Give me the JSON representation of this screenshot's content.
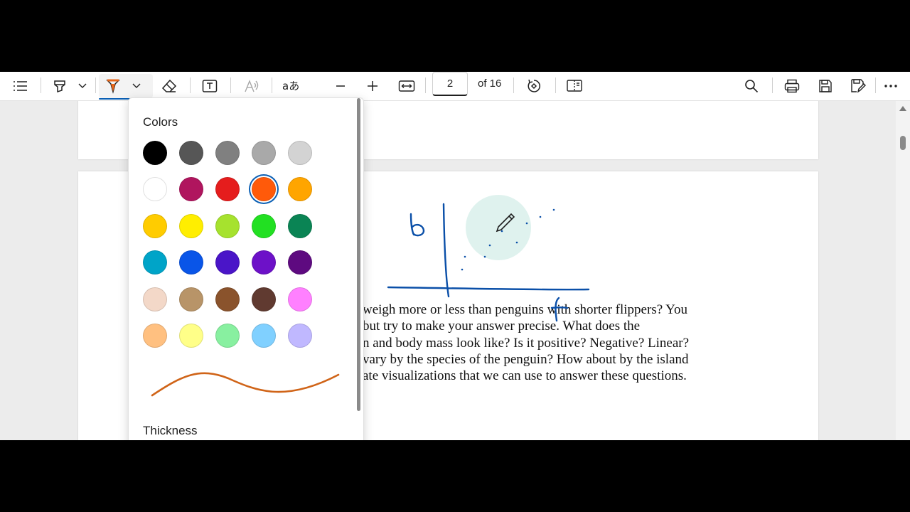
{
  "toolbar": {
    "page_number": "2",
    "page_of": "of 16",
    "icons": [
      "contents-icon",
      "highlight-icon",
      "chevron-down-icon",
      "draw-pen-icon",
      "chevron-down-icon",
      "eraser-icon",
      "text-box-icon",
      "read-aloud-icon",
      "translate-icon",
      "zoom-out-icon",
      "zoom-in-icon",
      "fit-width-icon",
      "rotate-icon",
      "page-view-icon",
      "search-icon",
      "print-icon",
      "save-icon",
      "save-as-icon",
      "more-icon"
    ],
    "pen_color": "#e8671a"
  },
  "color_panel": {
    "title": "Colors",
    "thickness_label": "Thickness",
    "selected_index": 8,
    "colors": [
      "#000000",
      "#565656",
      "#808080",
      "#a9a9a9",
      "#d3d3d3",
      "#ffffff",
      "#b0155e",
      "#e51d1d",
      "#ff5a0a",
      "#ffa500",
      "#ffcc00",
      "#ffee00",
      "#a6e22e",
      "#22e022",
      "#0a8454",
      "#00a4c8",
      "#0955e8",
      "#4a15c8",
      "#6d11c8",
      "#5e0a80",
      "#f3d8c8",
      "#b89468",
      "#8a532c",
      "#603a30",
      "#ff80ff",
      "#ffc080",
      "#ffff88",
      "#88f0a0",
      "#80d0ff",
      "#c0b8ff"
    ],
    "preview_color": "#d06418"
  },
  "document": {
    "paragraph_lines": [
      "weigh more or less than penguins with shorter flippers? You",
      "but try to make your answer precise. What does the",
      "n and body mass look like? Is it positive? Negative? Linear?",
      "vary by the species of the penguin? How about by the island",
      "ate visualizations that we can use to answer these questions."
    ],
    "ink_color": "#0a4fa8",
    "ink_label_y": "b",
    "ink_label_x": "f"
  }
}
